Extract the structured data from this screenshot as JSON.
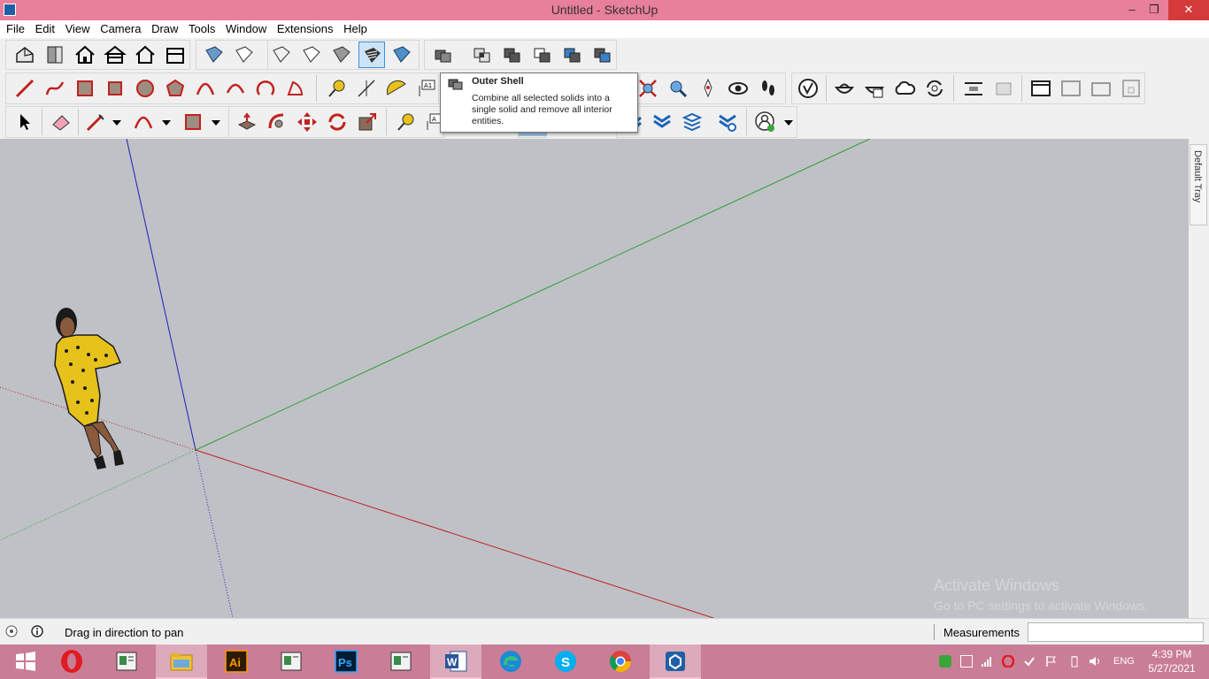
{
  "window": {
    "title": "Untitled - SketchUp",
    "controls": [
      "minimize",
      "maximize",
      "close"
    ]
  },
  "menubar": {
    "items": [
      "File",
      "Edit",
      "View",
      "Camera",
      "Draw",
      "Tools",
      "Window",
      "Extensions",
      "Help"
    ]
  },
  "toolbars": {
    "row1_icons": [
      "iso-view-icon",
      "top-view-icon",
      "home-icon",
      "front-house-icon",
      "right-house-icon",
      "back-house-icon",
      "left-house-icon",
      "xray-icon",
      "back-edges-icon",
      "wireframe-icon",
      "hidden-line-icon",
      "shaded-icon",
      "shaded-textures-icon",
      "monochrome-icon",
      "outer-shell-icon",
      "intersect-icon",
      "union-icon",
      "subtract-icon",
      "trim-icon",
      "split-icon"
    ],
    "selected_tool": "shaded-textures-icon",
    "row2_icons": [
      "line-icon",
      "freehand-icon",
      "rectangle-icon",
      "rotated-rectangle-icon",
      "circle-icon",
      "polygon-icon",
      "arc-icon",
      "two-point-arc-icon",
      "three-point-arc-icon",
      "pie-icon",
      "tape-measure-icon",
      "dimension-icon",
      "protractor-icon",
      "text-icon",
      "zoom-extents-icon",
      "previous-view-icon",
      "position-camera-icon",
      "look-around-icon",
      "walk-icon",
      "v-ray-icon",
      "warehouse-icon",
      "extension-manager-icon",
      "cloud-icon",
      "sync-icon",
      "section-plane-icon",
      "section-display-icon",
      "section-cut-icon",
      "window-icon",
      "scene-icon",
      "layout-icon",
      "lock-icon"
    ],
    "row3_icons": [
      "select-icon",
      "eraser-icon",
      "pencil-icon",
      "dropdown-icon",
      "arc-draw-icon",
      "dropdown-icon",
      "shapes-icon",
      "dropdown-icon",
      "push-pull-icon",
      "follow-me-icon",
      "move-icon",
      "rotate-icon",
      "scale-icon",
      "tape-icon",
      "text-label-icon",
      "sandbox-icon",
      "stamp-icon",
      "drape-icon",
      "profile-icon",
      "account-icon",
      "dropdown-icon"
    ]
  },
  "tooltip": {
    "title": "Outer Shell",
    "description": "Combine all selected solids into a single solid and remove all interior entities.",
    "icon": "outer-shell-icon"
  },
  "viewport": {
    "background": "#bfc1c7",
    "axis_colors": {
      "red": "#c0221f",
      "green": "#2f9e2f",
      "blue": "#1e1eb4"
    },
    "figure": "scale-figure-woman"
  },
  "tray": {
    "label": "Default Tray"
  },
  "watermark": {
    "line1": "Activate Windows",
    "line2": "Go to PC settings to activate Windows."
  },
  "statusbar": {
    "message": "Drag in direction to pan",
    "measurements_label": "Measurements",
    "measurements_value": ""
  },
  "taskbar": {
    "apps": [
      "windows-start-icon",
      "opera-icon",
      "file-viewer-icon",
      "file-explorer-icon",
      "illustrator-icon",
      "file-viewer-icon",
      "photoshop-icon",
      "file-viewer-icon",
      "word-icon",
      "edge-icon",
      "skype-icon",
      "chrome-icon",
      "sketchup-icon"
    ],
    "active_app": "sketchup-icon",
    "labels": {
      "illustrator": "Ai",
      "photoshop": "Ps",
      "word": "W"
    },
    "language": "ENG",
    "time": "4:39 PM",
    "date": "5/27/2021"
  }
}
